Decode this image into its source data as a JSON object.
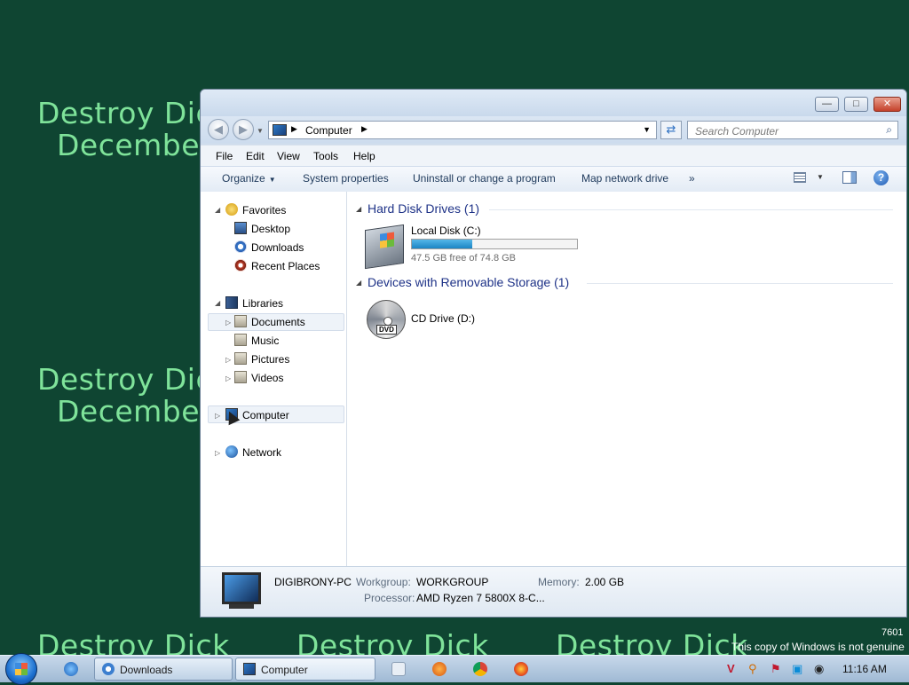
{
  "wallpaper": {
    "line1": "Destroy Dick",
    "line2": "December",
    "bottom": "Destroy Dick",
    "genuine_notice": "This copy of Windows is not genuine",
    "build": "7601",
    "text_color": "#7fe39a",
    "background_color": "#0f4532"
  },
  "window": {
    "controls": {
      "minimize": "—",
      "maximize": "□",
      "close": "✕"
    },
    "address": {
      "crumb": "Computer"
    },
    "search": {
      "placeholder": "Search Computer"
    },
    "menu": [
      "File",
      "Edit",
      "View",
      "Tools",
      "Help"
    ],
    "toolbar": {
      "organize": "Organize",
      "system_properties": "System properties",
      "uninstall": "Uninstall or change a program",
      "map_drive": "Map network drive",
      "more": "»"
    },
    "nav": {
      "favorites": "Favorites",
      "desktop": "Desktop",
      "downloads": "Downloads",
      "recent": "Recent Places",
      "libraries": "Libraries",
      "documents": "Documents",
      "music": "Music",
      "pictures": "Pictures",
      "videos": "Videos",
      "computer": "Computer",
      "network": "Network"
    },
    "content": {
      "hdd_group": "Hard Disk Drives (1)",
      "local_disk": {
        "name": "Local Disk (C:)",
        "free_text": "47.5 GB free of 74.8 GB",
        "used_fraction": 0.365
      },
      "removable_group": "Devices with Removable Storage (1)",
      "cd_drive": {
        "name": "CD Drive (D:)",
        "label": "DVD"
      }
    },
    "details": {
      "pc_name": "DIGIBRONY-PC",
      "workgroup_label": "Workgroup:",
      "workgroup": "WORKGROUP",
      "memory_label": "Memory:",
      "memory": "2.00 GB",
      "processor_label": "Processor:",
      "processor": "AMD Ryzen 7 5800X 8-C..."
    }
  },
  "taskbar": {
    "downloads_button": "Downloads",
    "computer_button": "Computer",
    "clock": "11:16 AM"
  }
}
